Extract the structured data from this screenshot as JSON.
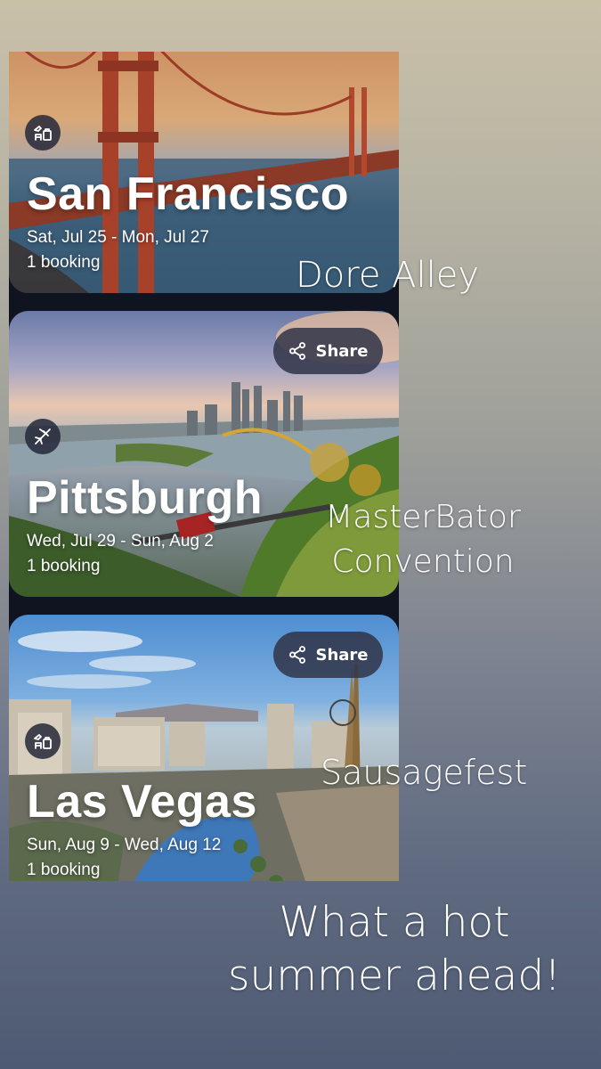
{
  "trips": [
    {
      "city": "San Francisco",
      "dates": "Sat, Jul 25 - Mon, Jul 27",
      "bookings": "1 booking",
      "icon": "hotel-flight-icon"
    },
    {
      "city": "Pittsburgh",
      "dates": "Wed, Jul 29 - Sun, Aug 2",
      "bookings": "1 booking",
      "icon": "flight-icon",
      "share_label": "Share"
    },
    {
      "city": "Las Vegas",
      "dates": "Sun, Aug 9 - Wed, Aug 12",
      "bookings": "1 booking",
      "icon": "hotel-flight-icon",
      "share_label": "Share"
    }
  ],
  "captions": {
    "sf": "Dore Alley",
    "pit_line1": "MasterBator",
    "pit_line2": "Convention",
    "lv": "Sausagefest",
    "footer_line1": "What a hot",
    "footer_line2": "summer ahead!"
  },
  "colors": {
    "share_button_bg": "#303448",
    "icon_circle_bg": "#24283a",
    "text": "#ffffff"
  }
}
